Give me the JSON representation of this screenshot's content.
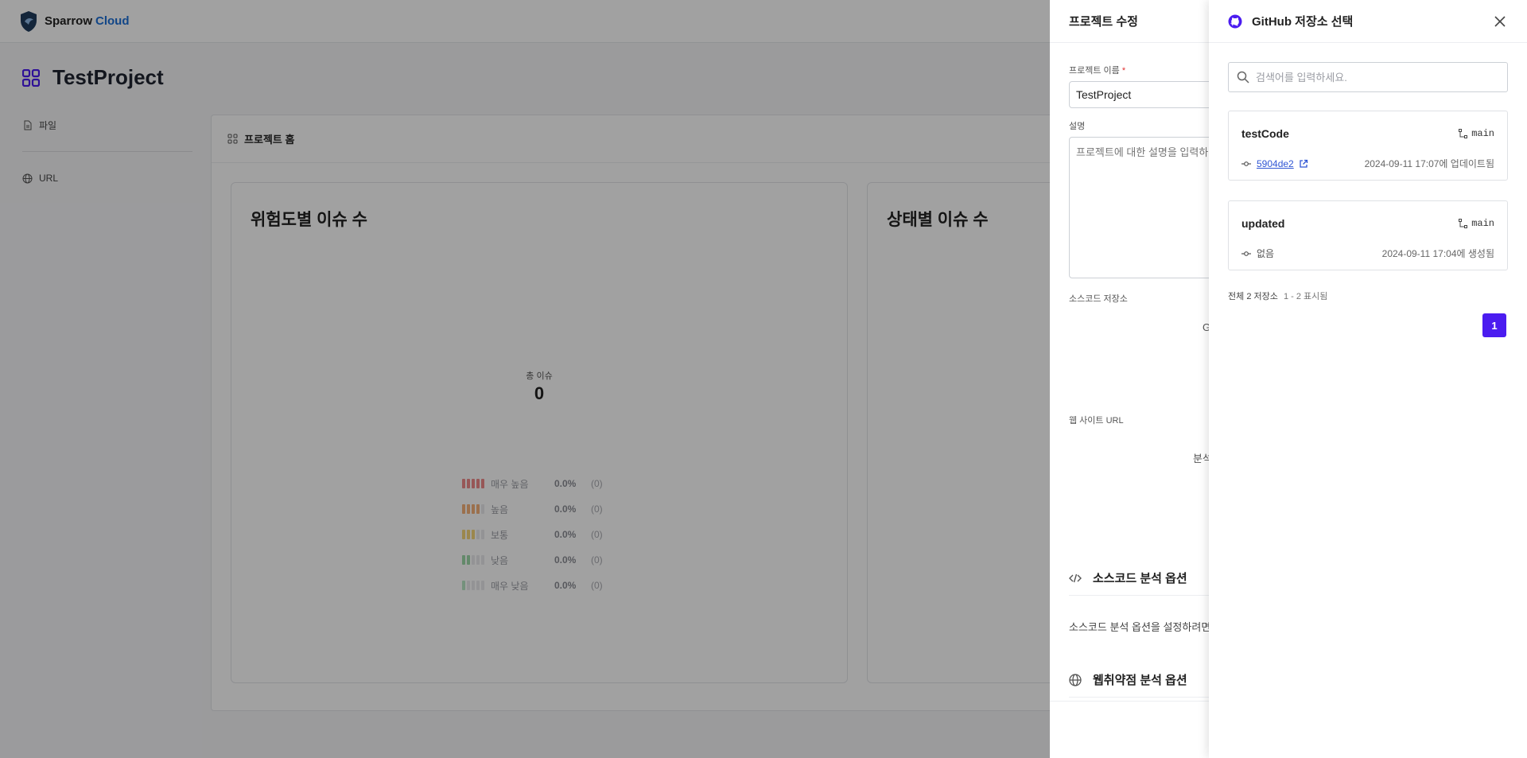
{
  "app": {
    "brand_part1": "Sparrow",
    "brand_part2": "Cloud"
  },
  "page": {
    "title": "TestProject"
  },
  "sidebar": {
    "items": [
      {
        "label": "파일",
        "icon": "file-icon"
      },
      {
        "label": "URL",
        "icon": "globe-icon"
      }
    ]
  },
  "main": {
    "header": "프로젝트 홈",
    "risk_card": {
      "title": "위험도별 이슈 수",
      "total_label": "총 이슈",
      "total_value": "0",
      "legend": [
        {
          "name": "매우 높음",
          "pct": "0.0%",
          "count": "(0)",
          "color": "#f08a8a",
          "level": 5
        },
        {
          "name": "높음",
          "pct": "0.0%",
          "count": "(0)",
          "color": "#f5b27a",
          "level": 4
        },
        {
          "name": "보통",
          "pct": "0.0%",
          "count": "(0)",
          "color": "#f5d67a",
          "level": 3
        },
        {
          "name": "낮음",
          "pct": "0.0%",
          "count": "(0)",
          "color": "#9ed9a8",
          "level": 2
        },
        {
          "name": "매우 낮음",
          "pct": "0.0%",
          "count": "(0)",
          "color": "#b8e6c4",
          "level": 1
        }
      ]
    },
    "status_card": {
      "title": "상태별 이슈 수"
    }
  },
  "edit_drawer": {
    "title": "프로젝트 수정",
    "name_label": "프로젝트 이름",
    "name_required": "*",
    "name_value": "TestProject",
    "desc_label": "설명",
    "desc_placeholder": "프로젝트에 대한 설명을 입력하",
    "source_label": "소스코드 저장소",
    "source_partial": "G",
    "website_label": "웹 사이트 URL",
    "website_partial": "분석",
    "source_options_title": "소스코드 분석 옵션",
    "source_options_desc": "소스코드 분석 옵션을 설정하려면",
    "web_options_title": "웹취약점 분석 옵션"
  },
  "repo_drawer": {
    "title": "GitHub 저장소 선택",
    "search_placeholder": "검색어를 입력하세요.",
    "repos": [
      {
        "name": "testCode",
        "branch": "main",
        "commit": "5904de2",
        "time": "2024-09-11 17:07에 업데이트됨"
      },
      {
        "name": "updated",
        "branch": "main",
        "commit": "없음",
        "time": "2024-09-11 17:04에 생성됨"
      }
    ],
    "summary_prefix": "전체",
    "summary_count": "2",
    "summary_unit": "저장소",
    "summary_range": "1 - 2 표시됨",
    "current_page": "1"
  },
  "colors": {
    "accent": "#4b1cf0",
    "brand_blue": "#1d6fd6",
    "link": "#2f55d4"
  }
}
